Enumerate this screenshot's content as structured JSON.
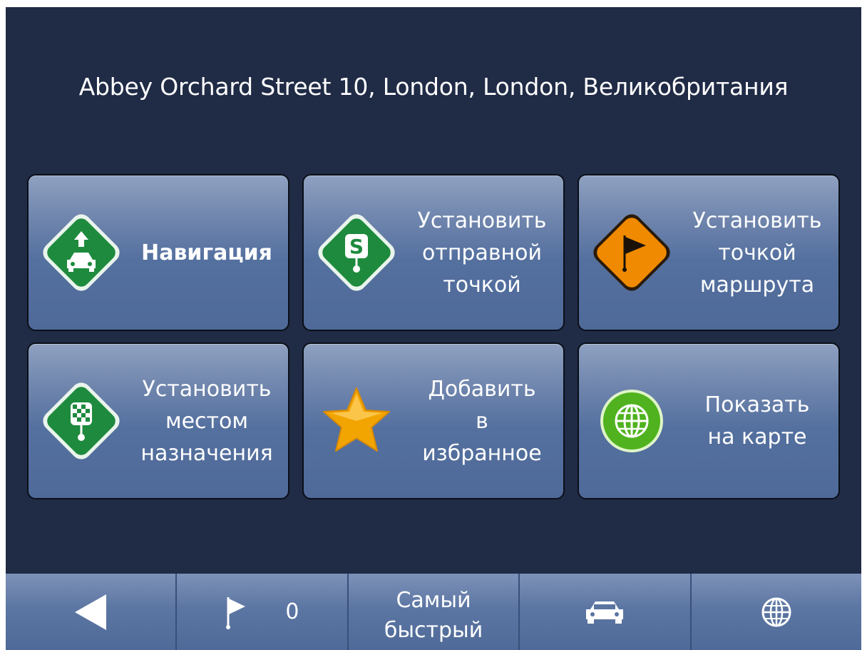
{
  "address": "Abbey Orchard Street 10, London, London, Великобритания",
  "tiles": [
    {
      "icon": "navigation-car-arrow-icon",
      "lines": [
        "Навигация"
      ]
    },
    {
      "icon": "start-point-s-icon",
      "lines": [
        "Установить",
        "отправной",
        "точкой"
      ]
    },
    {
      "icon": "waypoint-flag-icon",
      "lines": [
        "Установить",
        "точкой",
        "маршрута"
      ]
    },
    {
      "icon": "destination-checkered-icon",
      "lines": [
        "Установить",
        "местом",
        "назначения"
      ]
    },
    {
      "icon": "favorite-star-icon",
      "lines": [
        "Добавить",
        "в",
        "избранное"
      ]
    },
    {
      "icon": "globe-map-icon",
      "lines": [
        "Показать",
        "на карте"
      ]
    }
  ],
  "bottom_bar": {
    "back_icon": "back-arrow-icon",
    "waypoints_icon": "flag-icon",
    "waypoints_count": "0",
    "route_mode_line1": "Самый",
    "route_mode_line2": "быстрый",
    "vehicle_icon": "car-icon",
    "map_icon": "globe-icon"
  },
  "colors": {
    "background": "#202b46",
    "green_icon": "#1e8a3e",
    "orange_icon": "#f08a00",
    "star": "#f7b500"
  }
}
